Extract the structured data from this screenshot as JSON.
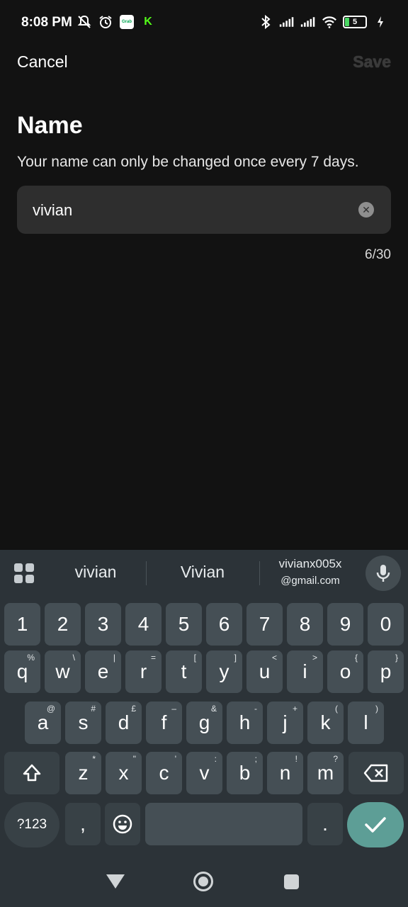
{
  "status_bar": {
    "time": "8:08 PM",
    "battery": "5",
    "left_icons": [
      "mute-icon",
      "alarm-icon",
      "grab-icon",
      "kick-icon"
    ],
    "right_icons": [
      "bluetooth-icon",
      "signal-icon",
      "signal-icon",
      "wifi-icon",
      "battery-icon",
      "charging-icon"
    ]
  },
  "header": {
    "cancel_label": "Cancel",
    "save_label": "Save"
  },
  "main": {
    "title": "Name",
    "description": "Your name can only be changed once every 7 days.",
    "name_value": "vivian",
    "char_count": "6/30"
  },
  "keyboard": {
    "suggestions": [
      "vivian",
      "Vivian"
    ],
    "email_suggestion_line1": "vivianx005x",
    "email_suggestion_line2": "@gmail.com",
    "row_numbers": [
      "1",
      "2",
      "3",
      "4",
      "5",
      "6",
      "7",
      "8",
      "9",
      "0"
    ],
    "row1": [
      {
        "k": "q",
        "h": "%"
      },
      {
        "k": "w",
        "h": "\\"
      },
      {
        "k": "e",
        "h": "|"
      },
      {
        "k": "r",
        "h": "="
      },
      {
        "k": "t",
        "h": "["
      },
      {
        "k": "y",
        "h": "]"
      },
      {
        "k": "u",
        "h": "<"
      },
      {
        "k": "i",
        "h": ">"
      },
      {
        "k": "o",
        "h": "{"
      },
      {
        "k": "p",
        "h": "}"
      }
    ],
    "row2": [
      {
        "k": "a",
        "h": "@"
      },
      {
        "k": "s",
        "h": "#"
      },
      {
        "k": "d",
        "h": "£"
      },
      {
        "k": "f",
        "h": "–"
      },
      {
        "k": "g",
        "h": "&"
      },
      {
        "k": "h",
        "h": "-"
      },
      {
        "k": "j",
        "h": "+"
      },
      {
        "k": "k",
        "h": "("
      },
      {
        "k": "l",
        "h": ")"
      }
    ],
    "row3": [
      {
        "k": "z",
        "h": "*"
      },
      {
        "k": "x",
        "h": "\""
      },
      {
        "k": "c",
        "h": "'"
      },
      {
        "k": "v",
        "h": ":"
      },
      {
        "k": "b",
        "h": ";"
      },
      {
        "k": "n",
        "h": "!"
      },
      {
        "k": "m",
        "h": "?"
      }
    ],
    "sym_label": "?123",
    "comma_label": ",",
    "period_label": ".",
    "accent_color": "#5d9e96"
  },
  "nav_bar": {
    "icons": [
      "back-icon",
      "home-icon",
      "recents-icon"
    ]
  }
}
